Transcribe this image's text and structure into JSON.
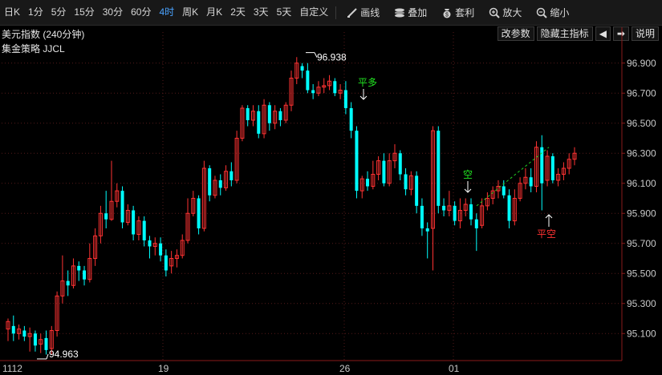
{
  "toolbar": {
    "periods": [
      "日K",
      "1分",
      "5分",
      "15分",
      "30分",
      "60分",
      "4时",
      "周K",
      "月K",
      "2天",
      "3天",
      "5天",
      "自定义"
    ],
    "active_period": "4时",
    "tools": [
      {
        "icon": "draw-line-icon",
        "label": "画线"
      },
      {
        "icon": "overlay-icon",
        "label": "叠加"
      },
      {
        "icon": "arbitrage-icon",
        "label": "套利"
      },
      {
        "icon": "zoom-in-icon",
        "label": "放大"
      },
      {
        "icon": "zoom-out-icon",
        "label": "缩小"
      }
    ]
  },
  "header": {
    "title": "美元指数 (240分钟)",
    "strategy": "集金策略 JJCL",
    "buttons": {
      "edit_params": "改参数",
      "hide_indicator": "隐藏主指标",
      "prev": "◀",
      "next": "➡",
      "help": "说明"
    }
  },
  "colors": {
    "up": "#ff3232",
    "down": "#00ffff",
    "grid": "#551a1a",
    "axis": "#8a1a1a",
    "text": "#c8c8c8",
    "signal_green": "#22e622",
    "signal_red": "#ff3232",
    "trend_line": "#22cc22"
  },
  "chart_data": {
    "type": "candlestick",
    "yticks": [
      "96.900",
      "96.700",
      "96.500",
      "96.300",
      "96.100",
      "95.900",
      "95.700",
      "95.500",
      "95.300",
      "95.100"
    ],
    "xticks": [
      "1112",
      "19",
      "26",
      "01"
    ],
    "max_label": "96.938",
    "min_label": "94.963",
    "ylim": [
      94.92,
      97.0
    ],
    "annotations": [
      {
        "text": "平多",
        "color": "green"
      },
      {
        "text": "空",
        "color": "green"
      },
      {
        "text": "平空",
        "color": "red"
      }
    ],
    "candles": [
      [
        95.13,
        95.18,
        95.05,
        95.2
      ],
      [
        95.15,
        95.1,
        95.05,
        95.22
      ],
      [
        95.1,
        95.13,
        95.06,
        95.16
      ],
      [
        95.12,
        95.08,
        95.05,
        95.15
      ],
      [
        95.08,
        95.1,
        94.98,
        95.14
      ],
      [
        95.1,
        95.02,
        94.98,
        95.12
      ],
      [
        95.03,
        95.06,
        94.97,
        95.1
      ],
      [
        95.07,
        94.99,
        94.96,
        95.12
      ],
      [
        95.0,
        95.12,
        94.96,
        95.15
      ],
      [
        95.12,
        95.35,
        95.08,
        95.38
      ],
      [
        95.35,
        95.45,
        95.3,
        95.62
      ],
      [
        95.45,
        95.42,
        95.35,
        95.52
      ],
      [
        95.42,
        95.55,
        95.4,
        95.6
      ],
      [
        95.55,
        95.52,
        95.45,
        95.58
      ],
      [
        95.52,
        95.46,
        95.42,
        95.55
      ],
      [
        95.46,
        95.6,
        95.44,
        95.7
      ],
      [
        95.6,
        95.75,
        95.55,
        95.8
      ],
      [
        95.75,
        95.9,
        95.7,
        95.95
      ],
      [
        95.9,
        95.86,
        95.8,
        96.05
      ],
      [
        95.86,
        95.98,
        95.85,
        96.25
      ],
      [
        95.98,
        96.05,
        95.94,
        96.1
      ],
      [
        96.05,
        95.84,
        95.8,
        96.08
      ],
      [
        95.84,
        95.92,
        95.82,
        95.96
      ],
      [
        95.92,
        95.76,
        95.72,
        95.95
      ],
      [
        95.76,
        95.85,
        95.72,
        95.88
      ],
      [
        95.85,
        95.72,
        95.68,
        95.88
      ],
      [
        95.72,
        95.68,
        95.6,
        95.75
      ],
      [
        95.68,
        95.7,
        95.62,
        95.74
      ],
      [
        95.7,
        95.62,
        95.58,
        95.74
      ],
      [
        95.62,
        95.52,
        95.48,
        95.66
      ],
      [
        95.55,
        95.6,
        95.5,
        95.65
      ],
      [
        95.6,
        95.62,
        95.54,
        95.66
      ],
      [
        95.62,
        95.72,
        95.6,
        95.76
      ],
      [
        95.72,
        95.9,
        95.7,
        96.0
      ],
      [
        95.9,
        96.0,
        95.88,
        96.05
      ],
      [
        96.0,
        95.8,
        95.76,
        96.02
      ],
      [
        95.8,
        96.2,
        95.78,
        96.25
      ],
      [
        96.2,
        96.02,
        95.98,
        96.22
      ],
      [
        96.02,
        96.12,
        96.0,
        96.15
      ],
      [
        96.12,
        96.07,
        96.02,
        96.16
      ],
      [
        96.07,
        96.18,
        96.05,
        96.22
      ],
      [
        96.18,
        96.12,
        96.08,
        96.24
      ],
      [
        96.12,
        96.4,
        96.1,
        96.45
      ],
      [
        96.4,
        96.6,
        96.38,
        96.62
      ],
      [
        96.6,
        96.52,
        96.48,
        96.62
      ],
      [
        96.52,
        96.58,
        96.48,
        96.62
      ],
      [
        96.58,
        96.43,
        96.4,
        96.62
      ],
      [
        96.43,
        96.62,
        96.4,
        96.66
      ],
      [
        96.62,
        96.5,
        96.45,
        96.64
      ],
      [
        96.5,
        96.58,
        96.46,
        96.62
      ],
      [
        96.58,
        96.52,
        96.48,
        96.6
      ],
      [
        96.52,
        96.62,
        96.5,
        96.64
      ],
      [
        96.62,
        96.8,
        96.58,
        96.85
      ],
      [
        96.8,
        96.9,
        96.76,
        96.94
      ],
      [
        96.88,
        96.85,
        96.8,
        96.9
      ],
      [
        96.85,
        96.72,
        96.7,
        96.9
      ],
      [
        96.72,
        96.7,
        96.66,
        96.76
      ],
      [
        96.7,
        96.74,
        96.68,
        96.78
      ],
      [
        96.74,
        96.75,
        96.7,
        96.8
      ],
      [
        96.75,
        96.78,
        96.72,
        96.82
      ],
      [
        96.78,
        96.7,
        96.68,
        96.8
      ],
      [
        96.7,
        96.72,
        96.66,
        96.76
      ],
      [
        96.72,
        96.6,
        96.56,
        96.78
      ],
      [
        96.6,
        96.45,
        96.4,
        96.64
      ],
      [
        96.45,
        96.05,
        96.0,
        96.48
      ],
      [
        96.05,
        96.13,
        96.0,
        96.15
      ],
      [
        96.13,
        96.08,
        96.05,
        96.18
      ],
      [
        96.08,
        96.16,
        96.06,
        96.25
      ],
      [
        96.16,
        96.25,
        96.12,
        96.28
      ],
      [
        96.25,
        96.1,
        96.08,
        96.3
      ],
      [
        96.1,
        96.25,
        96.08,
        96.3
      ],
      [
        96.25,
        96.3,
        96.2,
        96.36
      ],
      [
        96.3,
        96.16,
        96.12,
        96.32
      ],
      [
        96.16,
        96.06,
        96.02,
        96.2
      ],
      [
        96.06,
        96.15,
        96.02,
        96.18
      ],
      [
        96.15,
        95.95,
        95.9,
        96.18
      ],
      [
        95.95,
        95.8,
        95.75,
        96.0
      ],
      [
        95.8,
        95.78,
        95.6,
        95.84
      ],
      [
        95.8,
        96.45,
        95.52,
        96.48
      ],
      [
        96.45,
        95.95,
        95.9,
        96.48
      ],
      [
        95.95,
        95.92,
        95.88,
        96.0
      ],
      [
        95.92,
        95.95,
        95.88,
        96.05
      ],
      [
        95.95,
        95.85,
        95.82,
        95.98
      ],
      [
        95.85,
        95.92,
        95.8,
        96.0
      ],
      [
        95.92,
        95.96,
        95.88,
        96.0
      ],
      [
        95.96,
        95.86,
        95.82,
        96.0
      ],
      [
        95.86,
        95.8,
        95.65,
        95.9
      ],
      [
        95.82,
        95.95,
        95.8,
        96.0
      ],
      [
        95.95,
        96.0,
        95.92,
        96.04
      ],
      [
        96.0,
        96.05,
        95.96,
        96.08
      ],
      [
        96.05,
        96.08,
        96.0,
        96.12
      ],
      [
        96.08,
        96.02,
        96.0,
        96.12
      ],
      [
        96.02,
        95.85,
        95.8,
        96.06
      ],
      [
        95.85,
        96.0,
        95.82,
        96.06
      ],
      [
        96.0,
        96.1,
        95.98,
        96.14
      ],
      [
        96.1,
        96.14,
        96.06,
        96.2
      ],
      [
        96.14,
        96.08,
        96.04,
        96.2
      ],
      [
        96.08,
        96.34,
        96.04,
        96.38
      ],
      [
        96.34,
        96.1,
        95.92,
        96.42
      ],
      [
        96.12,
        96.28,
        96.08,
        96.32
      ],
      [
        96.28,
        96.12,
        96.1,
        96.3
      ],
      [
        96.12,
        96.16,
        96.08,
        96.2
      ],
      [
        96.16,
        96.2,
        96.12,
        96.24
      ],
      [
        96.2,
        96.26,
        96.16,
        96.3
      ],
      [
        96.26,
        96.3,
        96.22,
        96.34
      ]
    ]
  }
}
